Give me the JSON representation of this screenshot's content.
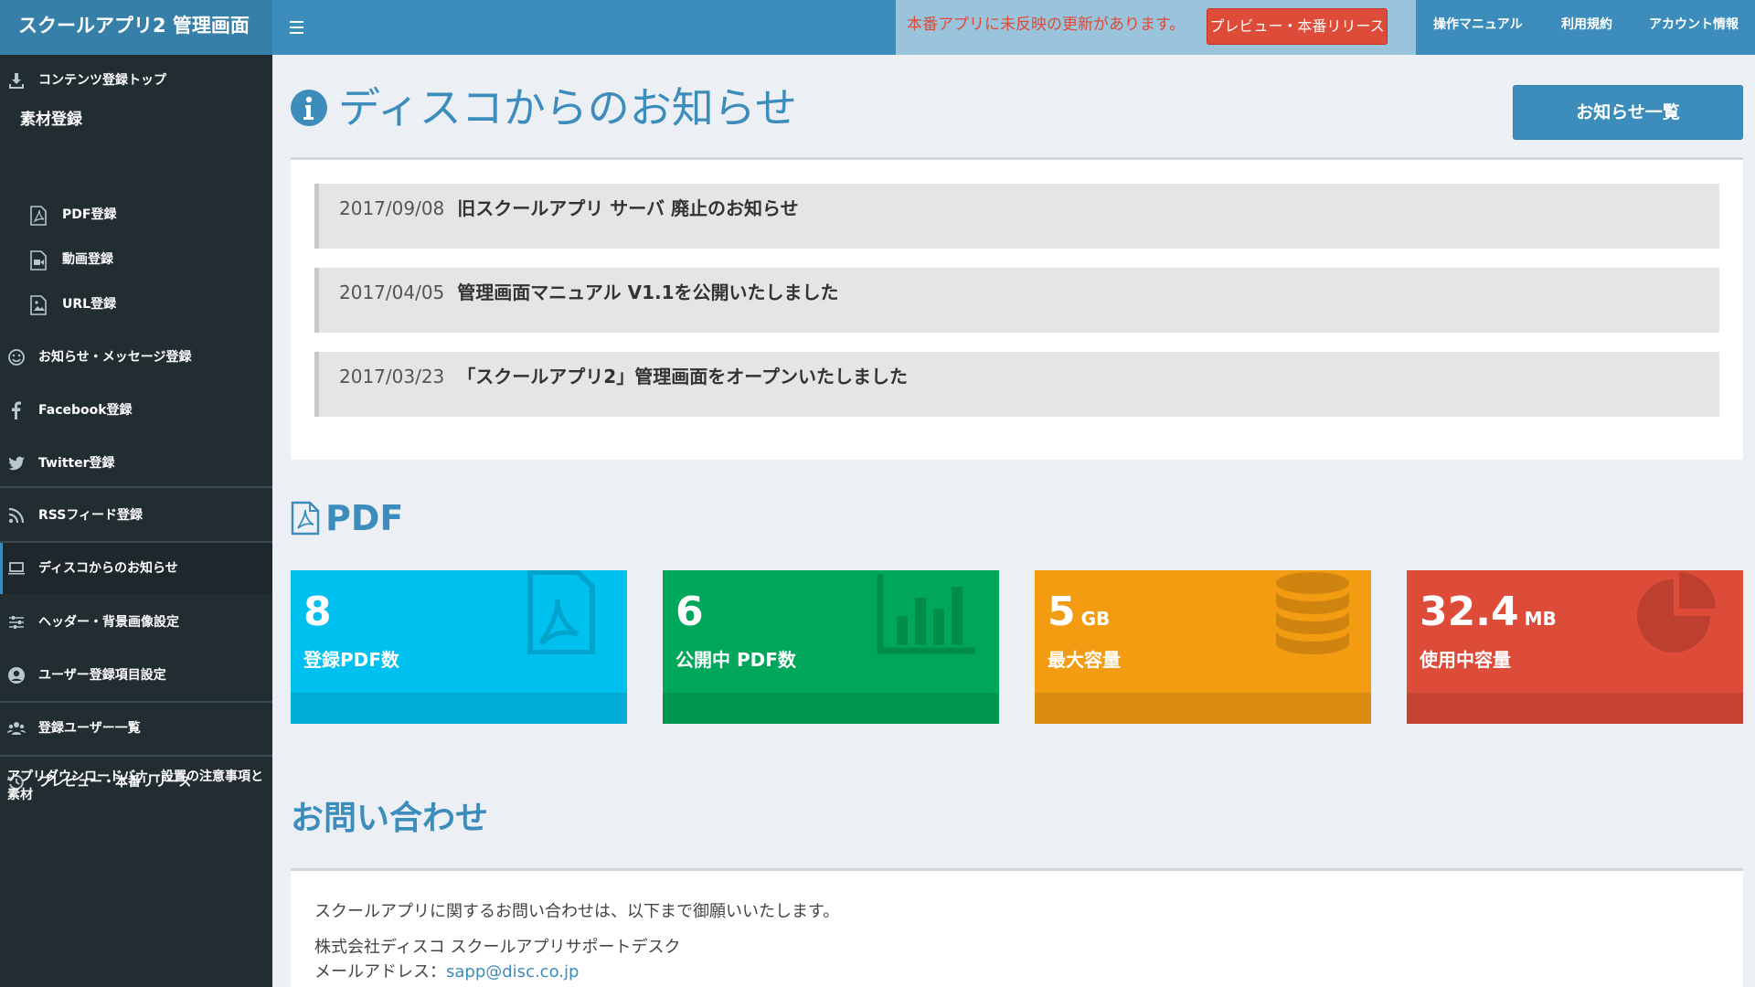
{
  "header": {
    "app_title": "スクールアプリ2 管理画面",
    "notice": "本番アプリに未反映の更新があります。",
    "release_button": "プレビュー・本番リリース",
    "nav": [
      "操作マニュアル",
      "利用規約",
      "アカウント情報"
    ]
  },
  "sidebar": {
    "top_item": "コンテンツ登録トップ",
    "material_header": "素材登録",
    "sub_items": [
      "PDF登録",
      "動画登録",
      "URL登録"
    ],
    "items": [
      "お知らせ・メッセージ登録",
      "Facebook登録",
      "Twitter登録",
      "RSSフィード登録",
      "ディスコからのお知らせ",
      "ヘッダー・背景画像設定",
      "ユーザー登録項目設定",
      "登録ユーザー一覧",
      "プレビュー・本番リリース"
    ],
    "banner_note": "アプリダウンロードバナー設置の注意事項と素材"
  },
  "main": {
    "page_title": "ディスコからのお知らせ",
    "list_button": "お知らせ一覧",
    "news": [
      {
        "date": "2017/09/08",
        "title": "旧スクールアプリ サーバ 廃止のお知らせ"
      },
      {
        "date": "2017/04/05",
        "title": "管理画面マニュアル V1.1を公開いたしました"
      },
      {
        "date": "2017/03/23",
        "title": "「スクールアプリ2」管理画面をオープンいたしました"
      }
    ],
    "pdf_section_title": "PDF",
    "stats": [
      {
        "value": "8",
        "unit": "",
        "label": "登録PDF数",
        "color": "#00c0ef",
        "icon": "pdf-file-icon"
      },
      {
        "value": "6",
        "unit": "",
        "label": "公開中 PDF数",
        "color": "#00a65a",
        "icon": "bar-chart-icon"
      },
      {
        "value": "5",
        "unit": "GB",
        "label": "最大容量",
        "color": "#f39c12",
        "icon": "database-icon"
      },
      {
        "value": "32.4",
        "unit": "MB",
        "label": "使用中容量",
        "color": "#dd4b39",
        "icon": "pie-chart-icon"
      }
    ],
    "contact": {
      "title": "お問い合わせ",
      "intro": "スクールアプリに関するお問い合わせは、以下まで御願いいたします。",
      "company": "株式会社ディスコ スクールアプリサポートデスク",
      "email_label": "メールアドレス：",
      "email": "sapp@disc.co.jp"
    }
  },
  "colors": {
    "header": "#3c8dbc",
    "logo_bg": "#367fa9",
    "sidebar": "#222d32",
    "notice_text": "#dd4b39",
    "content_bg": "#ecf0f5"
  }
}
